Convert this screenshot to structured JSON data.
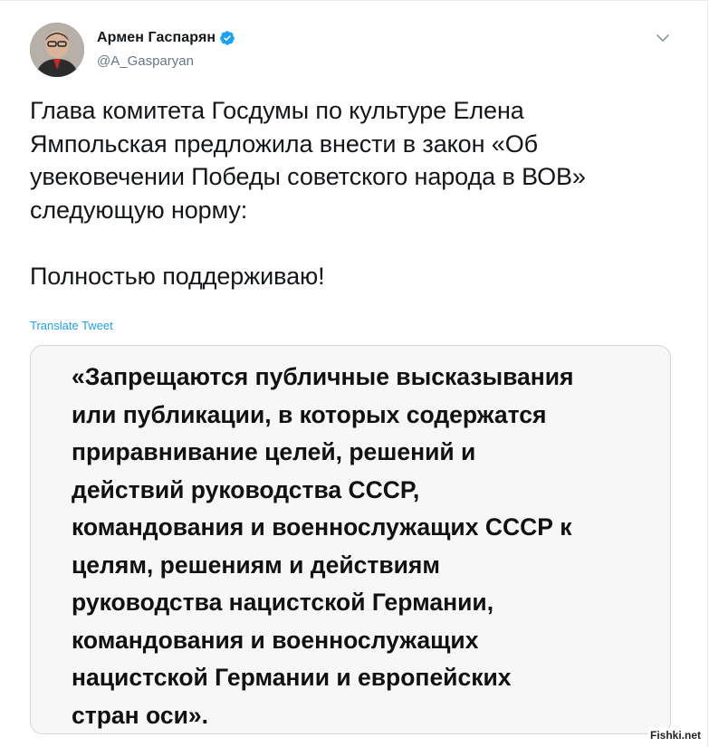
{
  "author": {
    "display_name": "Армен Гаспарян",
    "handle": "@A_Gasparyan",
    "verified": true,
    "avatar_icon": "person-avatar-icon"
  },
  "tweet": {
    "text_lines": [
      "Глава комитета Госдумы по культуре Елена",
      "Ямпольская предложила внести в закон «Об",
      "увековечении Победы советского народа в ВОВ»",
      "следующую норму:"
    ],
    "closing": "Полностью поддерживаю!",
    "translate_label": "Translate Tweet"
  },
  "media": {
    "quote_lines": [
      "«Запрещаются публичные высказывания",
      "или публикации, в которых содержатся",
      "приравнивание целей, решений и",
      "действий руководства СССР,",
      "командования и военнослужащих СССР к",
      "целям, решениям и действиям",
      "руководства нацистской Германии,",
      "командования и военнослужащих",
      "нацистской Германии и европейских",
      "стран оси»."
    ]
  },
  "watermark": "Fishki.net",
  "colors": {
    "link": "#1da1f2",
    "handle": "#657786",
    "text": "#14171a",
    "verified_badge": "#1da1f2"
  }
}
